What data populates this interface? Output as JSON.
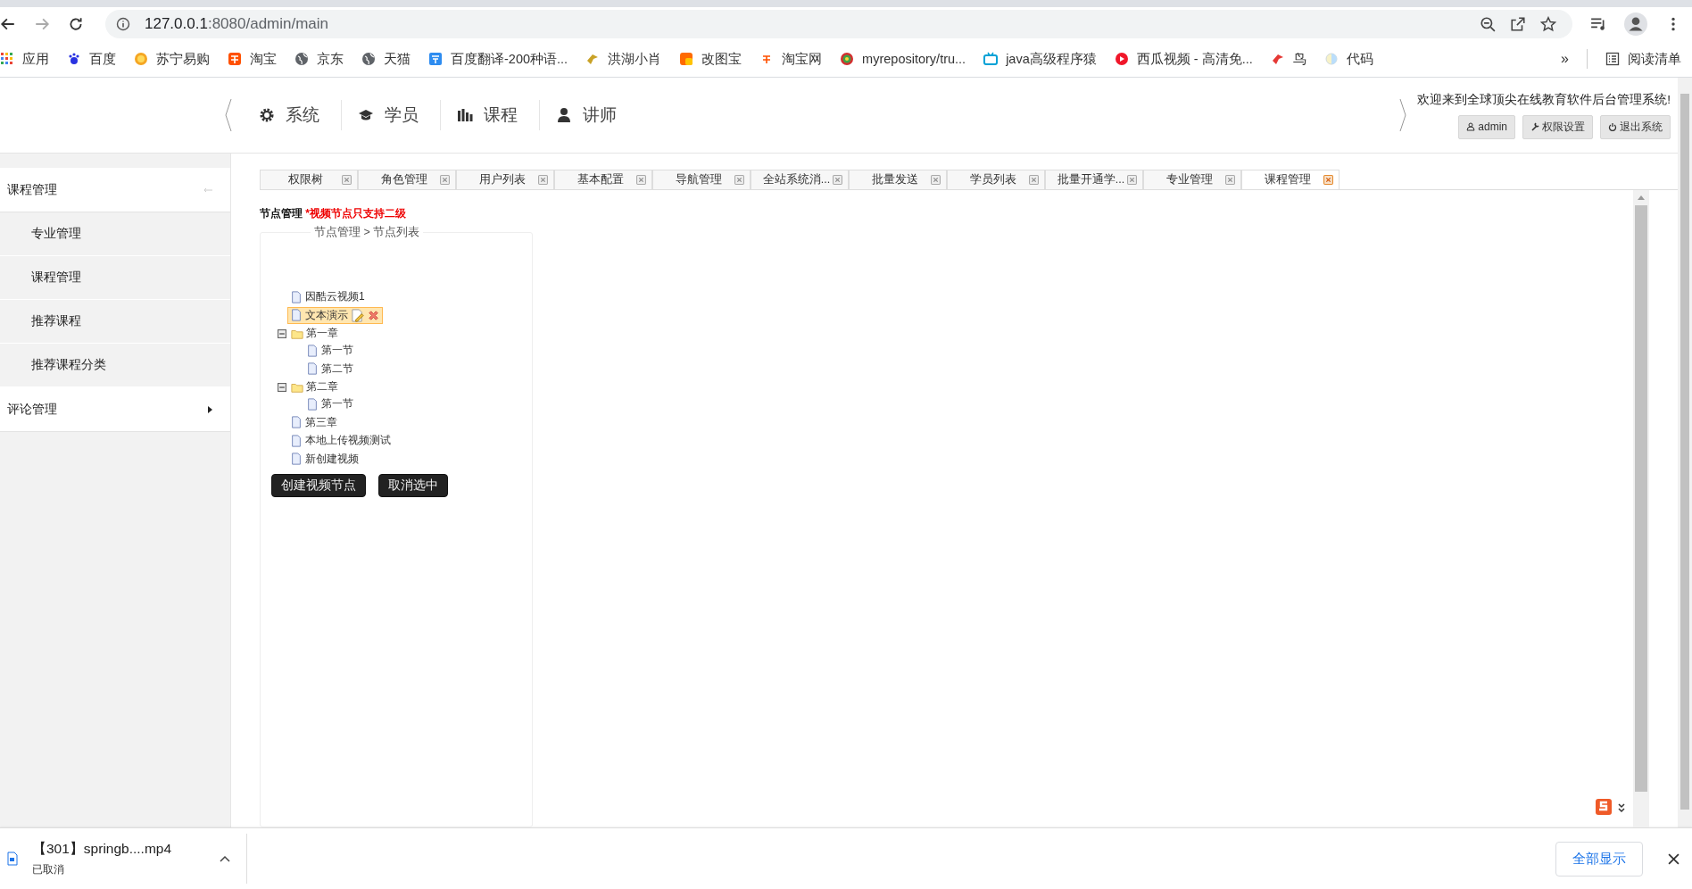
{
  "browser": {
    "url_host": "127.0.0.1",
    "url_rest": ":8080/admin/main",
    "bookmarks": [
      "应用",
      "百度",
      "苏宁易购",
      "淘宝",
      "京东",
      "天猫",
      "百度翻译-200种语...",
      "洪湖小肖",
      "改图宝",
      "淘宝网",
      "myrepository/tru...",
      "java高级程序猿",
      "西瓜视频 - 高清免...",
      "鸟",
      "代码"
    ],
    "overflow": "»",
    "reading_list": "阅读清单"
  },
  "header": {
    "nav": [
      "系统",
      "学员",
      "课程",
      "讲师"
    ],
    "welcome": "欢迎来到全球顶尖在线教育软件后台管理系统!",
    "buttons": [
      "admin",
      "权限设置",
      "退出系统"
    ]
  },
  "sidebar": [
    {
      "label": "课程管理",
      "expanded": true,
      "children": [
        {
          "label": "专业管理"
        },
        {
          "label": "课程管理"
        },
        {
          "label": "推荐课程"
        },
        {
          "label": "推荐课程分类"
        }
      ]
    },
    {
      "label": "评论管理",
      "expanded": false
    }
  ],
  "tabs": [
    {
      "label": "权限树",
      "selected": false
    },
    {
      "label": "角色管理",
      "selected": false
    },
    {
      "label": "用户列表",
      "selected": false
    },
    {
      "label": "基本配置",
      "selected": false
    },
    {
      "label": "导航管理",
      "selected": false
    },
    {
      "label": "全站系统消...",
      "selected": false
    },
    {
      "label": "批量发送",
      "selected": false
    },
    {
      "label": "学员列表",
      "selected": false
    },
    {
      "label": "批量开通学...",
      "selected": false
    },
    {
      "label": "专业管理",
      "selected": false
    },
    {
      "label": "课程管理",
      "selected": true
    }
  ],
  "content": {
    "title": "节点管理",
    "note": "*视频节点只支持二级",
    "legend": "节点管理 > 节点列表",
    "tree": [
      {
        "label": "因酷云视频1",
        "kind": "file",
        "selected": false
      },
      {
        "label": "文本演示",
        "kind": "file",
        "selected": true
      },
      {
        "label": "第一章",
        "kind": "folder",
        "selected": false,
        "expanded": true,
        "children": [
          {
            "label": "第一节",
            "kind": "file",
            "selected": false
          },
          {
            "label": "第二节",
            "kind": "file",
            "selected": false
          }
        ]
      },
      {
        "label": "第二章",
        "kind": "folder",
        "selected": false,
        "expanded": true,
        "children": [
          {
            "label": "第一节",
            "kind": "file",
            "selected": false
          }
        ]
      },
      {
        "label": "第三章",
        "kind": "file",
        "selected": false
      },
      {
        "label": "本地上传视频测试",
        "kind": "file",
        "selected": false
      },
      {
        "label": "新创建视频",
        "kind": "file",
        "selected": false
      }
    ],
    "buttons": [
      "创建视频节点",
      "取消选中"
    ]
  },
  "download": {
    "file": "【301】springb....mp4",
    "status": "已取消",
    "show_all": "全部显示"
  }
}
